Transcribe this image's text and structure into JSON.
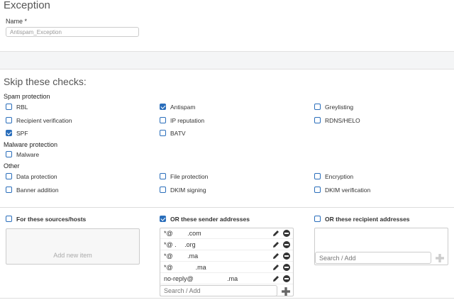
{
  "title": "Exception",
  "name_field": {
    "label": "Name *",
    "value": "Antispam_Exception"
  },
  "skip_title": "Skip these checks:",
  "sections": {
    "spam": "Spam protection",
    "malware": "Malware protection",
    "other": "Other"
  },
  "checks": {
    "rbl": {
      "label": "RBL",
      "checked": false
    },
    "antispam": {
      "label": "Antispam",
      "checked": true
    },
    "greylisting": {
      "label": "Greylisting",
      "checked": false
    },
    "recipient_verification": {
      "label": "Recipient verification",
      "checked": false
    },
    "ip_reputation": {
      "label": "IP reputation",
      "checked": false
    },
    "rdns_helo": {
      "label": "RDNS/HELO",
      "checked": false
    },
    "spf": {
      "label": "SPF",
      "checked": true
    },
    "batv": {
      "label": "BATV",
      "checked": false
    },
    "malware": {
      "label": "Malware",
      "checked": false
    },
    "data_protection": {
      "label": "Data protection",
      "checked": false
    },
    "file_protection": {
      "label": "File protection",
      "checked": false
    },
    "encryption": {
      "label": "Encryption",
      "checked": false
    },
    "banner_addition": {
      "label": "Banner addition",
      "checked": false
    },
    "dkim_signing": {
      "label": "DKIM signing",
      "checked": false
    },
    "dkim_verification": {
      "label": "DKIM verification",
      "checked": false
    }
  },
  "sources": {
    "label": "For these sources/hosts",
    "checked": false,
    "add_placeholder": "Add new item"
  },
  "senders": {
    "label": "OR these sender addresses",
    "checked": true,
    "items": [
      "*@   .com",
      "*@ .  .org",
      "*@   .ma",
      "*@     .ma",
      "no-reply@      .ma"
    ],
    "search_placeholder": "Search / Add"
  },
  "recipients": {
    "label": "OR these recipient addresses",
    "checked": false,
    "search_placeholder": "Search / Add"
  }
}
